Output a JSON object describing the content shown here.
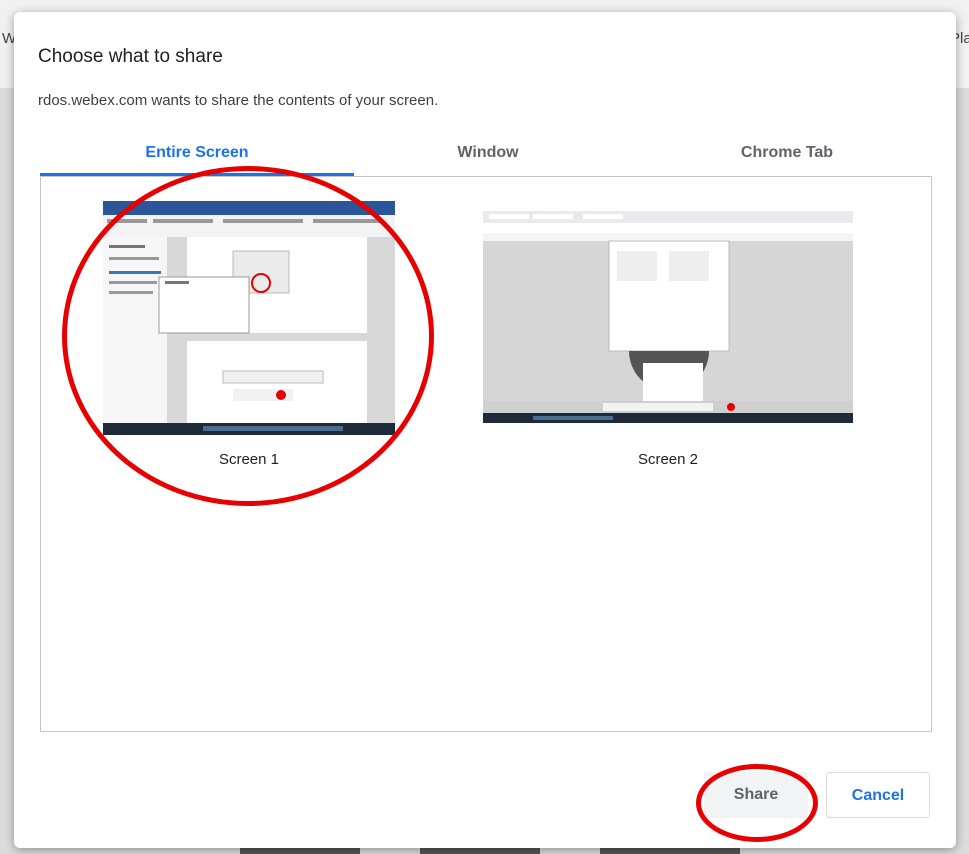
{
  "dialog": {
    "title": "Choose what to share",
    "subtitle": "rdos.webex.com wants to share the contents of your screen."
  },
  "tabs": [
    {
      "label": "Entire Screen",
      "active": true
    },
    {
      "label": "Window",
      "active": false
    },
    {
      "label": "Chrome Tab",
      "active": false
    }
  ],
  "screens": [
    {
      "label": "Screen 1",
      "selected": true
    },
    {
      "label": "Screen 2",
      "selected": false
    }
  ],
  "buttons": {
    "share_label": "Share",
    "cancel_label": "Cancel"
  },
  "background": {
    "left_letter": "W",
    "right_letters": "Pla"
  },
  "colors": {
    "accent": "#1a73e8",
    "annotation": "#e60000"
  }
}
